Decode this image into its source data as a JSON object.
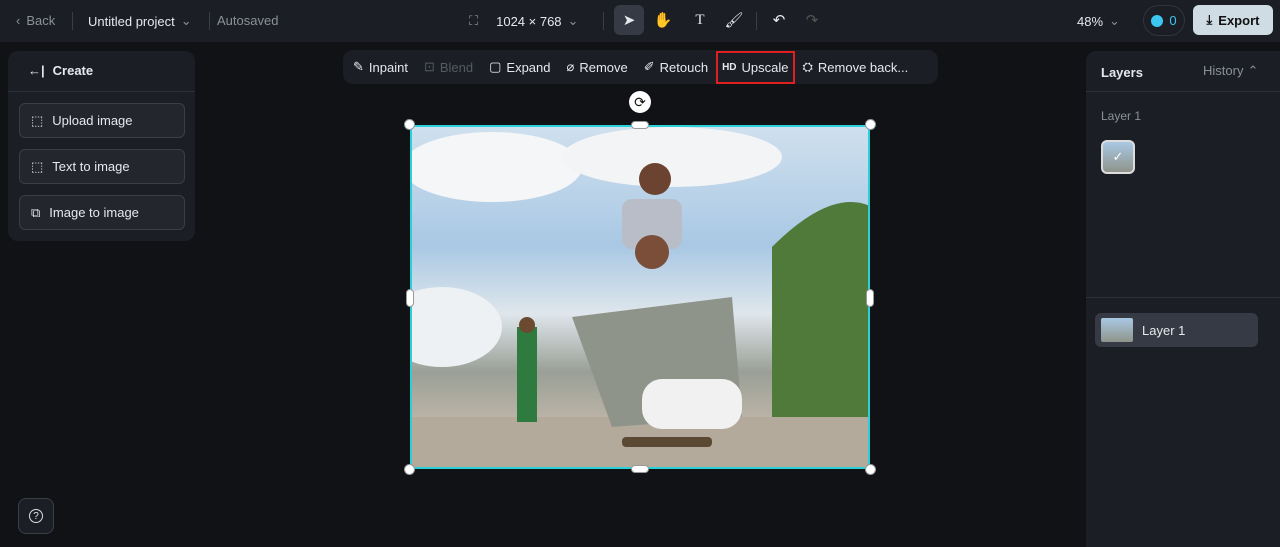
{
  "topbar": {
    "back": "Back",
    "project": "Untitled project",
    "status": "Autosaved",
    "size": "1024 × 768",
    "zoom": "48%",
    "credits": "0",
    "export": "Export"
  },
  "create": {
    "title": "Create",
    "buttons": [
      "Upload image",
      "Text to image",
      "Image to image"
    ]
  },
  "edit_tools": [
    "Inpaint",
    "Blend",
    "Expand",
    "Remove",
    "Retouch",
    "Upscale",
    "Remove back..."
  ],
  "upscale_badge": "HD",
  "right": {
    "layers_tab": "Layers",
    "history_tab": "History",
    "layer_group": "Layer 1",
    "layer_item": "Layer 1"
  },
  "colors": {
    "accent": "#2ad0d6",
    "highlight": "#e02020"
  }
}
